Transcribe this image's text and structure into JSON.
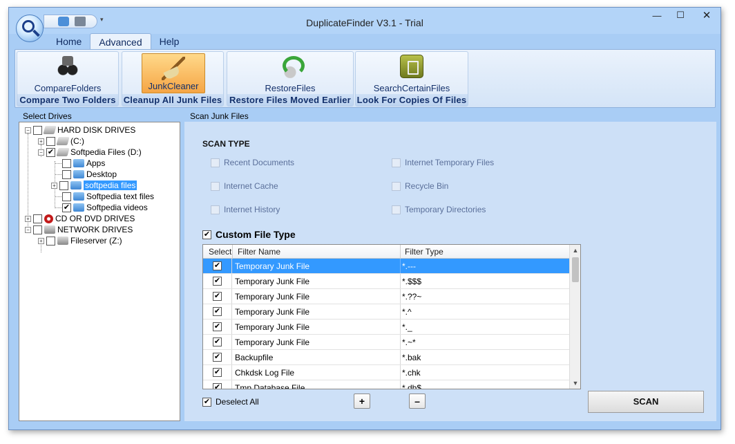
{
  "window": {
    "title": "DuplicateFinder V3.1 - Trial",
    "controls": {
      "minimize": "—",
      "maximize": "☐",
      "close": "✕"
    }
  },
  "ribbon": {
    "tabs": [
      {
        "label": "Home",
        "active": false
      },
      {
        "label": "Advanced",
        "active": true
      },
      {
        "label": "Help",
        "active": false
      }
    ],
    "groups": [
      {
        "button": "CompareFolders",
        "caption": "Compare Two Folders",
        "icon": "binoculars-icon"
      },
      {
        "button": "JunkCleaner",
        "caption": "Cleanup All Junk Files",
        "icon": "broom-icon",
        "active": true
      },
      {
        "button": "RestoreFiles",
        "caption": "Restore Files Moved Earlier",
        "icon": "restore-icon"
      },
      {
        "button": "SearchCertainFiles",
        "caption": "Look For Copies Of Files",
        "icon": "search-files-icon"
      }
    ]
  },
  "left_panel": {
    "label": "Select Drives",
    "tree": [
      {
        "label": "HARD DISK DRIVES",
        "checked": false
      },
      {
        "label": "(C:)",
        "checked": false
      },
      {
        "label": "Softpedia Files (D:)",
        "checked": true
      },
      {
        "label": "Apps",
        "checked": false
      },
      {
        "label": "Desktop",
        "checked": false
      },
      {
        "label": "softpedia files",
        "checked": false,
        "selected": true
      },
      {
        "label": "Softpedia text files",
        "checked": false
      },
      {
        "label": "Softpedia videos",
        "checked": true
      },
      {
        "label": "CD OR DVD DRIVES",
        "checked": false
      },
      {
        "label": "NETWORK DRIVES",
        "checked": false
      },
      {
        "label": "Fileserver (Z:)",
        "checked": false
      }
    ]
  },
  "right_panel": {
    "label": "Scan Junk Files",
    "scan_type_heading": "SCAN TYPE",
    "options": [
      "Recent Documents",
      "Internet Temporary Files",
      "Internet Cache",
      "Recycle Bin",
      "Internet History",
      "Temporary Directories"
    ],
    "custom_file_type": {
      "label": "Custom File Type",
      "checked": true
    },
    "grid": {
      "headers": {
        "select": "Select",
        "name": "Filter Name",
        "type": "Filter Type"
      },
      "rows": [
        {
          "name": "Temporary Junk File",
          "type": "*.---",
          "checked": true,
          "selected": true
        },
        {
          "name": "Temporary Junk File",
          "type": "*.$$$",
          "checked": true
        },
        {
          "name": "Temporary Junk File",
          "type": "*.??~",
          "checked": true
        },
        {
          "name": "Temporary Junk File",
          "type": "*.^",
          "checked": true
        },
        {
          "name": "Temporary Junk File",
          "type": "*._",
          "checked": true
        },
        {
          "name": "Temporary Junk File",
          "type": "*.~*",
          "checked": true
        },
        {
          "name": "Backupfile",
          "type": "*.bak",
          "checked": true
        },
        {
          "name": "Chkdsk Log File",
          "type": "*.chk",
          "checked": true
        },
        {
          "name": "Tmp Database File",
          "type": "*.db$",
          "checked": true
        }
      ]
    },
    "deselect_all": {
      "label": "Deselect All",
      "checked": true
    },
    "add_label": "+",
    "remove_label": "–",
    "scan_label": "SCAN"
  }
}
